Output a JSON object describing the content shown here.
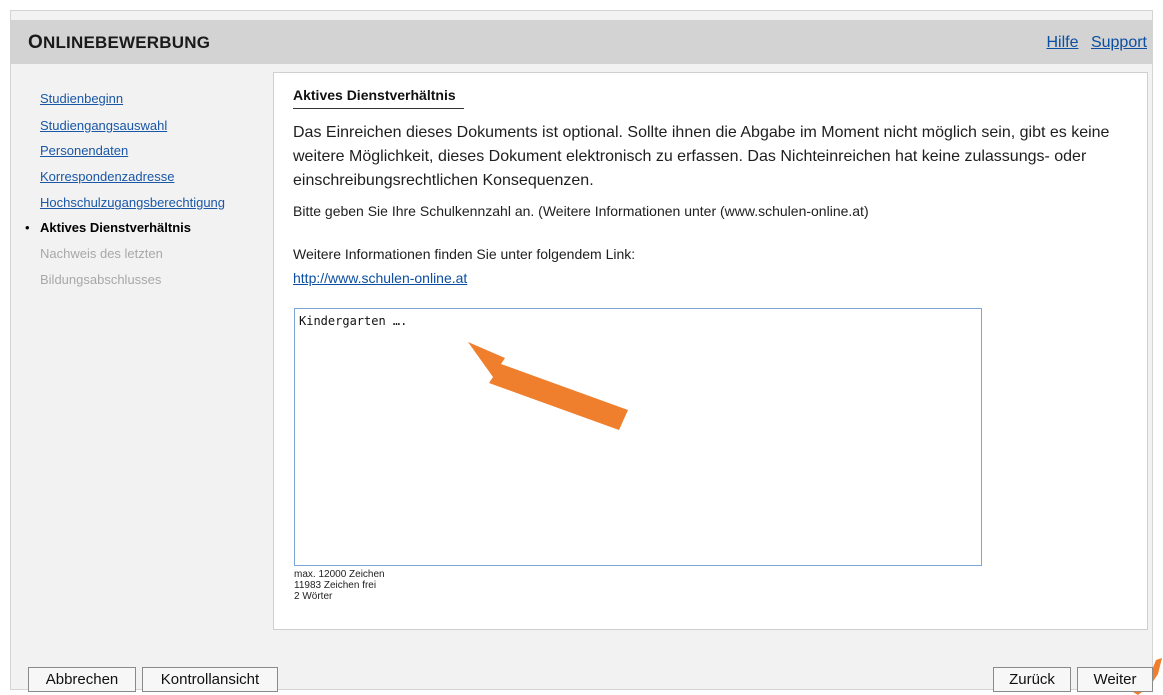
{
  "header": {
    "title_first_letter": "O",
    "title_rest": "NLINEBEWERBUNG",
    "links": [
      "Hilfe",
      "Support"
    ]
  },
  "sidebar": {
    "items": [
      {
        "label": "Studienbeginn",
        "state": "link"
      },
      {
        "label": "Studiengangsauswahl",
        "state": "link"
      },
      {
        "label": "Personendaten",
        "state": "link"
      },
      {
        "label": "Korrespondenzadresse",
        "state": "link"
      },
      {
        "label": "Hochschulzugangsberechtigung",
        "state": "link"
      },
      {
        "label": "Aktives Dienstverhältnis",
        "state": "active"
      },
      {
        "label": "Nachweis des letzten",
        "state": "disabled"
      },
      {
        "label": "Bildungsabschlusses",
        "state": "disabled"
      }
    ],
    "bullet": "•"
  },
  "content": {
    "section_title": "Aktives Dienstverhältnis",
    "intro": "Das Einreichen dieses Dokuments ist optional. Sollte ihnen die Abgabe im Moment nicht möglich sein, gibt es keine weitere Möglichkeit, dieses Dokument elektronisch zu erfassen. Das Nichteinreichen hat keine zulassungs- oder einschreibungsrechtlichen Konsequenzen.",
    "hint": "Bitte geben Sie Ihre Schulkennzahl an. (Weitere Informationen unter (www.schulen-online.at)",
    "more_info": "Weitere Informationen finden Sie unter folgendem Link:",
    "link": "http://www.schulen-online.at",
    "textarea_value": "Kindergarten ….",
    "counter": {
      "max": "max. 12000 Zeichen",
      "free": "11983 Zeichen frei",
      "words": "2 Wörter"
    }
  },
  "footer": {
    "cancel": "Abbrechen",
    "review": "Kontrollansicht",
    "back": "Zurück",
    "next": "Weiter"
  },
  "colors": {
    "header_bg": "#d3d3d3",
    "link": "#1a57a6",
    "annotation_arrow": "#ef7f2d"
  },
  "icons": {
    "annotation_arrow": "arrow-icon"
  }
}
